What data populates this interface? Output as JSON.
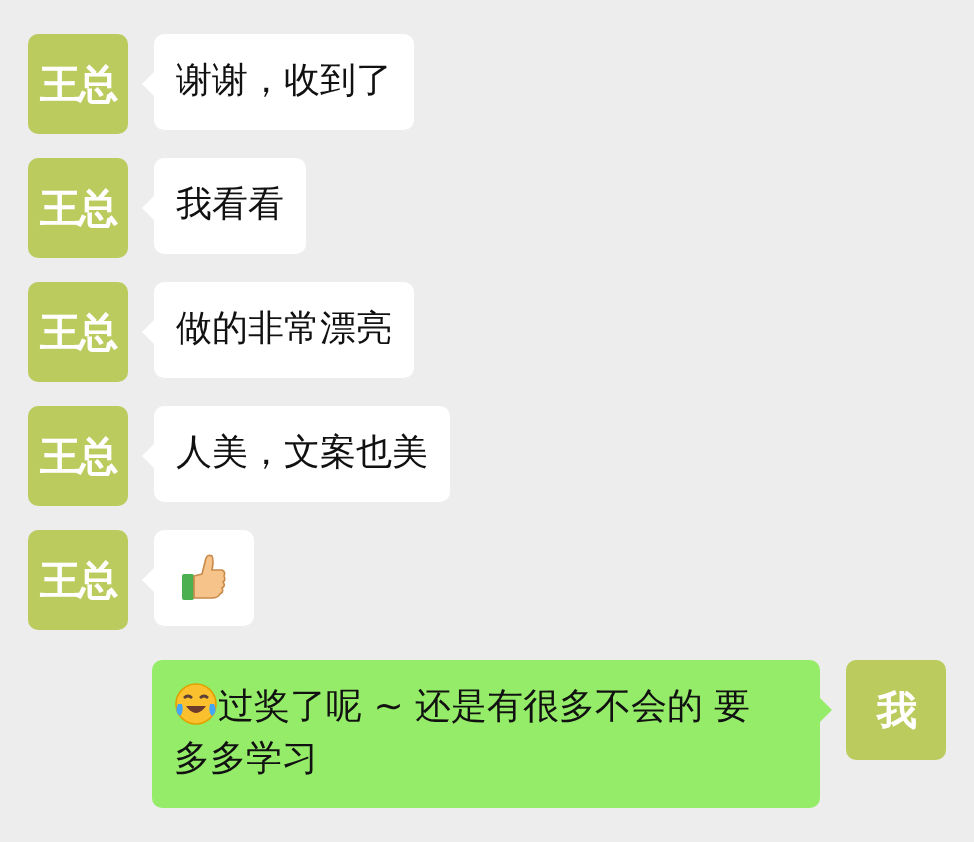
{
  "messages": [
    {
      "outgoing": false,
      "avatar": "王总",
      "kind": "text",
      "text": "谢谢，收到了"
    },
    {
      "outgoing": false,
      "avatar": "王总",
      "kind": "text",
      "text": "我看看"
    },
    {
      "outgoing": false,
      "avatar": "王总",
      "kind": "text",
      "text": "做的非常漂亮"
    },
    {
      "outgoing": false,
      "avatar": "王总",
      "kind": "text",
      "text": "人美，文案也美"
    },
    {
      "outgoing": false,
      "avatar": "王总",
      "kind": "thumbs_up"
    },
    {
      "outgoing": true,
      "avatar": "我",
      "kind": "emoji_text",
      "text": "过奖了呢 ~ 还是有很多不会的 要多多学习"
    }
  ]
}
